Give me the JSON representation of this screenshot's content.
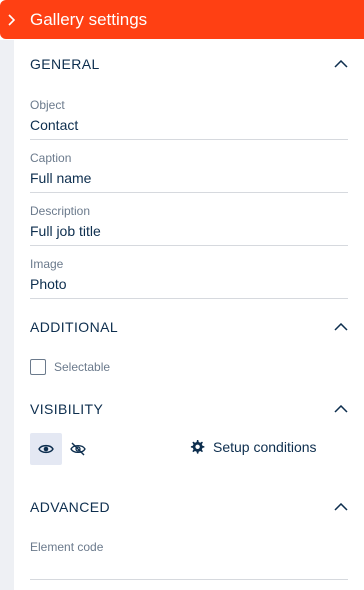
{
  "header": {
    "title": "Gallery settings"
  },
  "sections": {
    "general": {
      "title": "GENERAL",
      "fields": [
        {
          "label": "Object",
          "value": "Contact"
        },
        {
          "label": "Caption",
          "value": "Full name"
        },
        {
          "label": "Description",
          "value": "Full job title"
        },
        {
          "label": "Image",
          "value": "Photo"
        }
      ]
    },
    "additional": {
      "title": "ADDITIONAL",
      "selectable": {
        "label": "Selectable",
        "checked": false
      }
    },
    "visibility": {
      "title": "VISIBILITY",
      "visible_selected": true,
      "setup_conditions_label": "Setup conditions"
    },
    "advanced": {
      "title": "ADVANCED",
      "element_code": {
        "label": "Element code",
        "value": ""
      }
    }
  },
  "colors": {
    "header_bg": "#ff4013",
    "text_primary": "#0d2e4e",
    "text_secondary": "#6b7a8c",
    "divider": "#d6d9de",
    "toggle_active_bg": "#e4e8f3"
  },
  "icons": {
    "header_toggle": "chevron-right-icon",
    "section_toggle": "chevron-up-icon",
    "visible": "eye-icon",
    "hidden": "eye-off-icon",
    "setup": "gear-icon"
  }
}
